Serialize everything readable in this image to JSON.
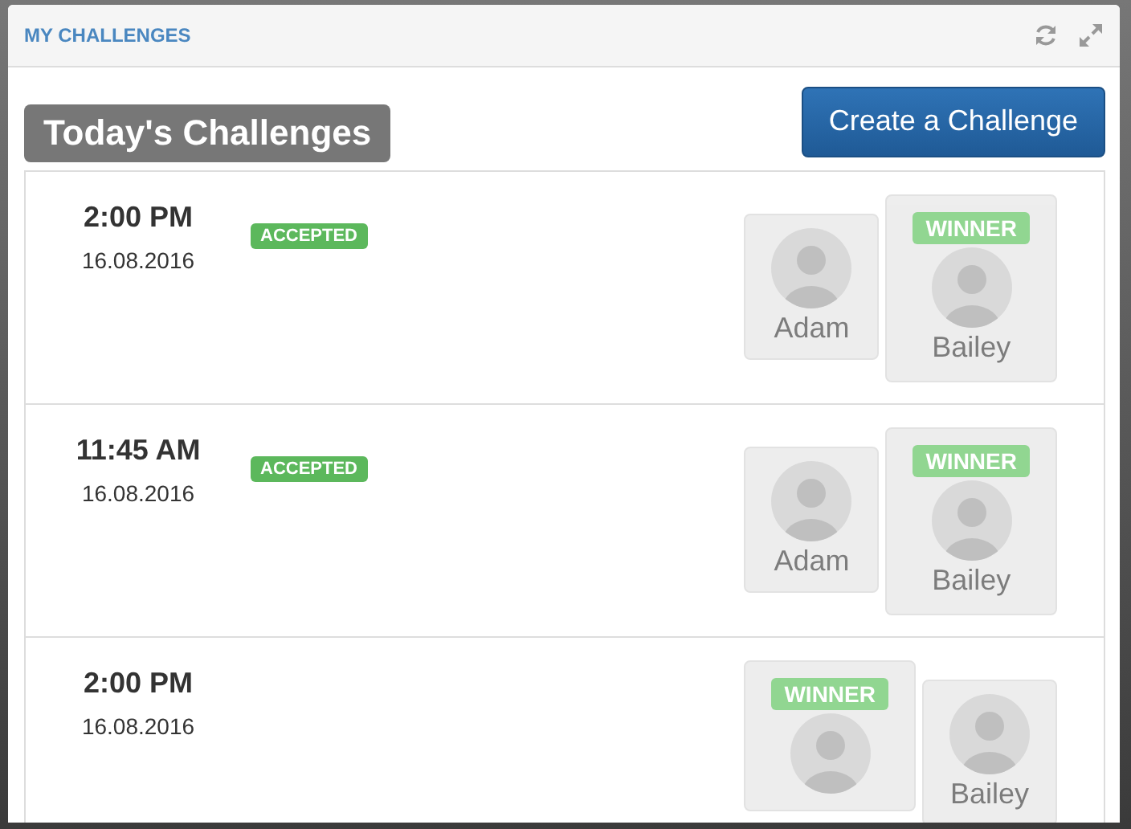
{
  "panel": {
    "title": "MY CHALLENGES"
  },
  "heading": "Today's Challenges",
  "create_button": "Create a Challenge",
  "challenges": [
    {
      "time": "2:00 PM",
      "date": "16.08.2016",
      "status": "ACCEPTED",
      "participants": [
        {
          "name": "Adam",
          "winner": false
        },
        {
          "name": "Bailey",
          "winner": true,
          "winner_label": "WINNER"
        }
      ]
    },
    {
      "time": "11:45 AM",
      "date": "16.08.2016",
      "status": "ACCEPTED",
      "participants": [
        {
          "name": "Adam",
          "winner": false
        },
        {
          "name": "Bailey",
          "winner": true,
          "winner_label": "WINNER"
        }
      ]
    },
    {
      "time": "2:00 PM",
      "date": "16.08.2016",
      "participants": [
        {
          "winner": true,
          "winner_label": "WINNER"
        },
        {
          "name": "Bailey",
          "winner": false
        }
      ]
    }
  ]
}
